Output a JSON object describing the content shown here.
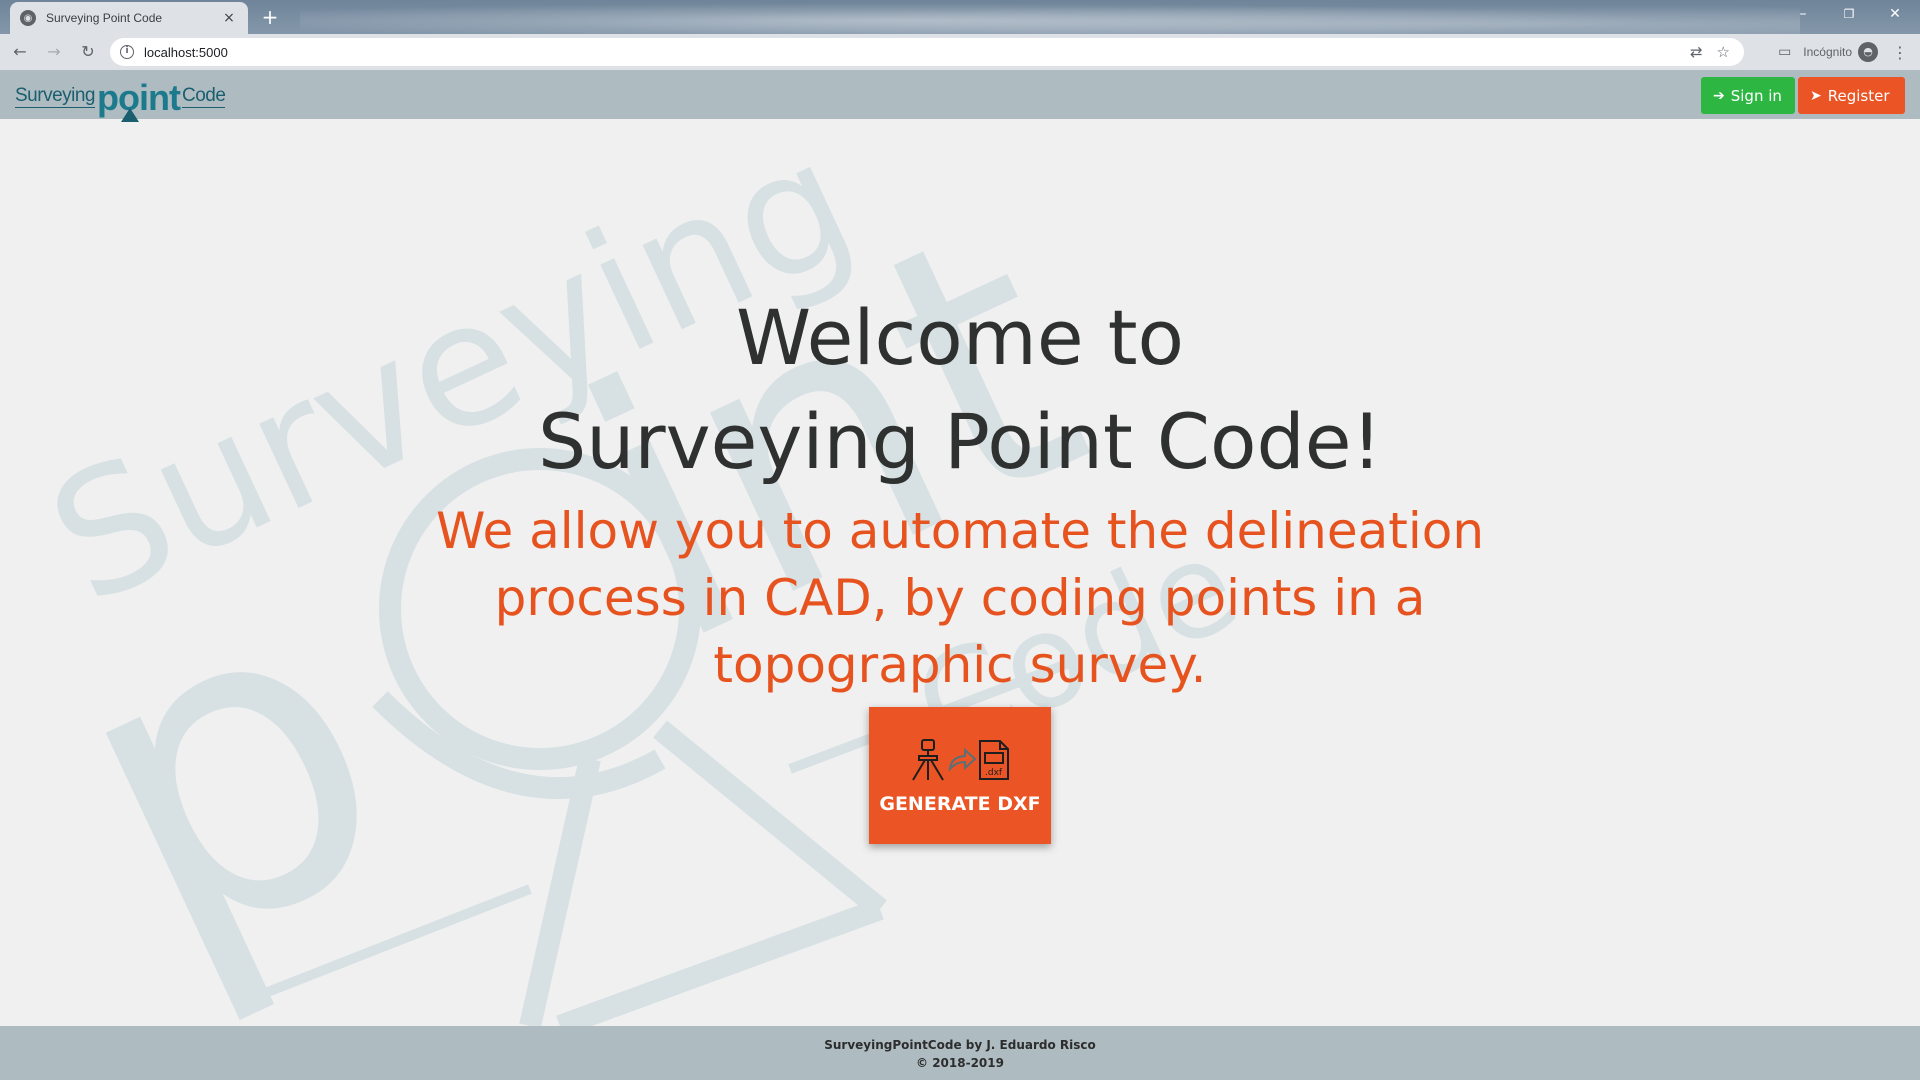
{
  "browser": {
    "tab_title": "Surveying Point Code",
    "tab_close": "×",
    "new_tab": "+",
    "url": "localhost:5000",
    "incognito_label": "Incógnito",
    "window_controls": [
      "–",
      "❐",
      "✕"
    ]
  },
  "header": {
    "logo": {
      "part1": "Surveying",
      "part2": "point",
      "part3": "Code"
    },
    "signin_label": "Sign in",
    "register_label": "Register",
    "signin_color": "#2db742",
    "register_color": "#eb5424"
  },
  "hero": {
    "title_line1": "Welcome to",
    "title_line2": "Surveying Point Code!",
    "subtitle": "We allow you to automate the delineation process in CAD, by coding points in a topographic survey.",
    "generate_label": "GENERATE DXF",
    "icons": [
      "tripod-icon",
      "arrow-icon",
      "dxf-file-icon"
    ],
    "accent": "#e7531f"
  },
  "footer": {
    "credit": "SurveyingPointCode by J. Eduardo Risco",
    "copyright": "© 2018-2019"
  }
}
